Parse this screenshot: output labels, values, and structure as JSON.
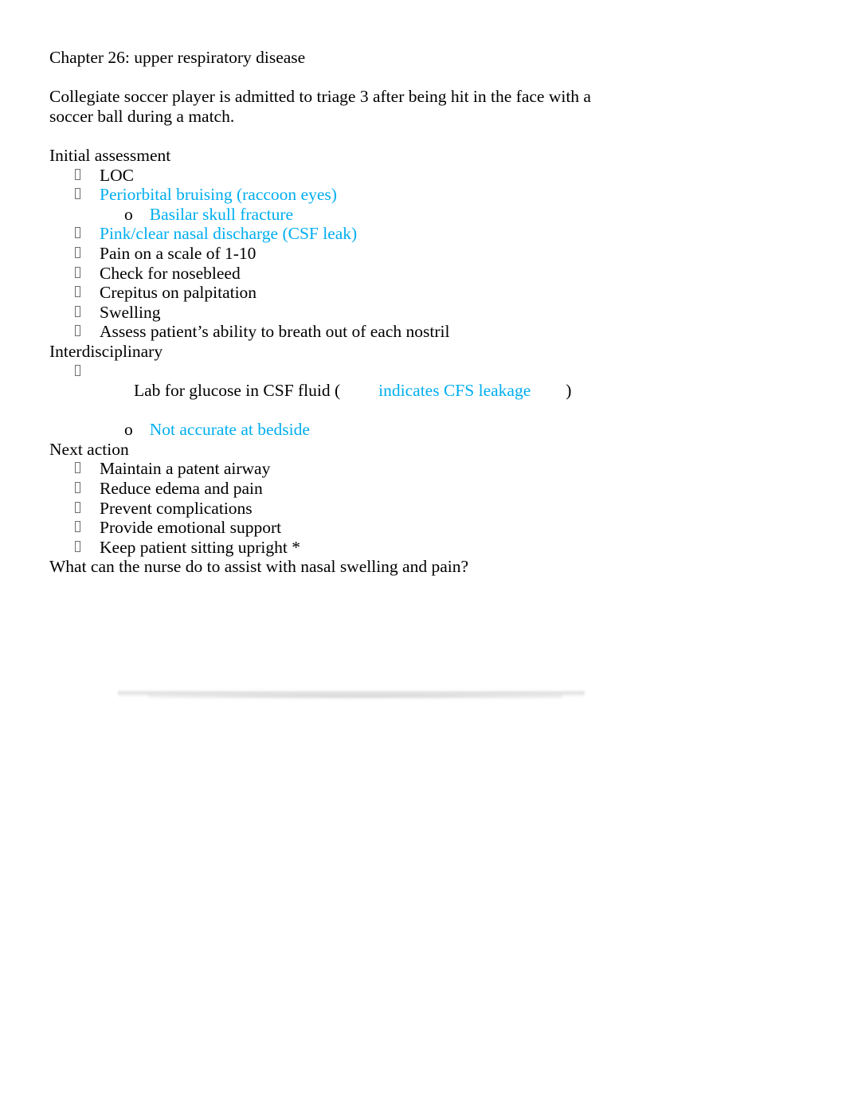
{
  "document": {
    "title_line": "Chapter 26: upper respiratory disease",
    "scenario": "Collegiate soccer player is admitted to triage 3 after being hit in the face with a soccer ball during a match.",
    "closing_question": "What can the nurse do to assist with nasal swelling and pain?"
  },
  "colors": {
    "highlight_cyan": "#00AEEF",
    "body_black": "#000000",
    "bullet_grey": "#6E6E6E",
    "page_background": "#FFFFFF"
  },
  "markers": {
    "level1_icon": "tofu-box-bullet-icon",
    "level2_label": "o"
  },
  "sections": [
    {
      "heading": "Initial assessment",
      "items": [
        {
          "text": "LOC",
          "color": "black",
          "level": 1
        },
        {
          "text": "Periorbital bruising (raccoon eyes)",
          "color": "cyan",
          "level": 1
        },
        {
          "text": "Basilar skull fracture",
          "color": "cyan",
          "level": 2
        },
        {
          "text": "Pink/clear nasal discharge (CSF leak)",
          "color": "cyan",
          "level": 1
        },
        {
          "text": "Pain on a scale of 1-10",
          "color": "black",
          "level": 1
        },
        {
          "text": "Check for nosebleed",
          "color": "black",
          "level": 1
        },
        {
          "text": "Crepitus on palpitation",
          "color": "black",
          "level": 1
        },
        {
          "text": "Swelling",
          "color": "black",
          "level": 1
        },
        {
          "text": "Assess patient’s ability to breath out of each nostril",
          "color": "black",
          "level": 1
        }
      ]
    },
    {
      "heading": "Interdisciplinary",
      "items": [
        {
          "text": "Lab for glucose in CSF fluid (",
          "color": "black",
          "level": 1,
          "split": true
        },
        {
          "text": "Not accurate at bedside",
          "color": "cyan",
          "level": 2
        }
      ]
    },
    {
      "heading": "Next action",
      "items": [
        {
          "text": "Maintain a patent airway",
          "color": "black",
          "level": 1
        },
        {
          "text": "Reduce edema and pain",
          "color": "black",
          "level": 1
        },
        {
          "text": "Prevent complications",
          "color": "black",
          "level": 1
        },
        {
          "text": "Provide emotional support",
          "color": "black",
          "level": 1
        },
        {
          "text": "Keep patient sitting upright *",
          "color": "black",
          "level": 1
        }
      ]
    }
  ],
  "lab_line": {
    "prefix": "Lab for glucose in CSF fluid (",
    "highlight": "indicates CFS leakage",
    "suffix": ")"
  }
}
